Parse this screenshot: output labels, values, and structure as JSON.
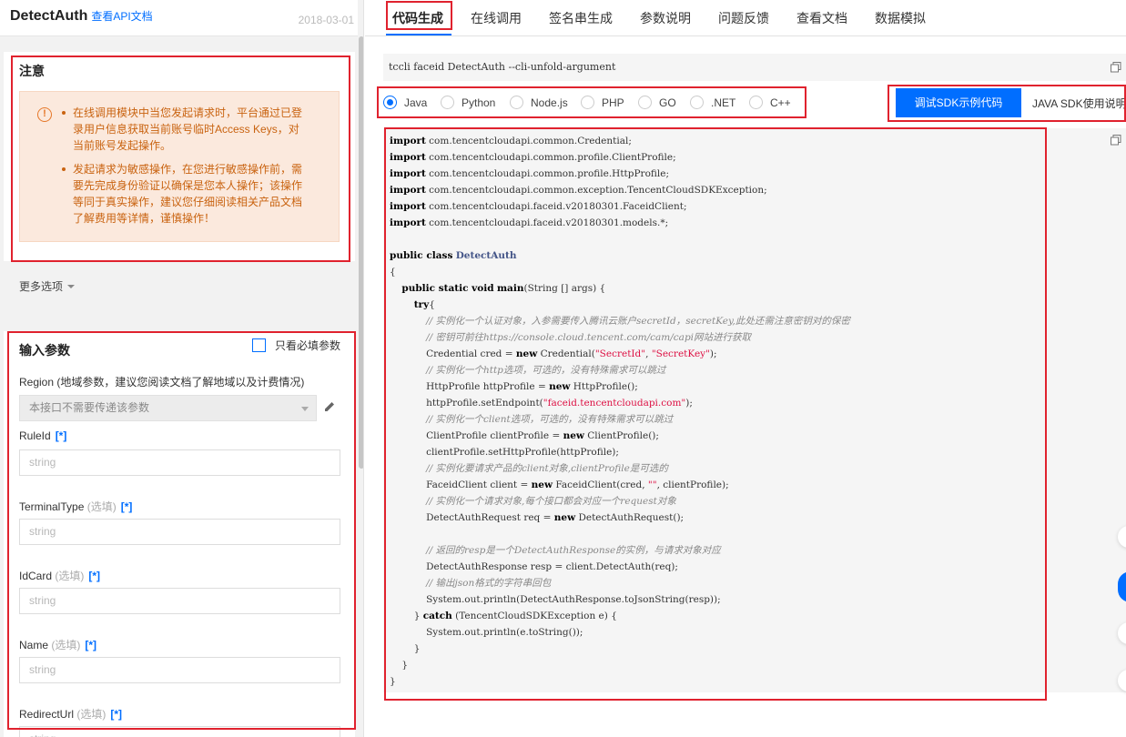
{
  "left": {
    "api_name": "DetectAuth",
    "api_doc_link": "查看API文档",
    "date": "2018-03-01",
    "notice": {
      "title": "注意",
      "items": [
        "在线调用模块中当您发起请求时，平台通过已登录用户信息获取当前账号临时Access Keys，对当前账号发起操作。",
        "发起请求为敏感操作，在您进行敏感操作前，需要先完成身份验证以确保是您本人操作；该操作等同于真实操作，建议您仔细阅读相关产品文档了解费用等详情，谨慎操作！"
      ]
    },
    "more_options": "更多选项",
    "params": {
      "title": "输入参数",
      "required_only_label": "只看必填参数",
      "region_label": "Region",
      "region_hint": "(地域参数，建议您阅读文档了解地域以及计费情况)",
      "region_placeholder": "本接口不需要传递该参数",
      "optional_text": "(选填)",
      "required_mark": "[*]",
      "fields": [
        {
          "name": "RuleId",
          "optional": false,
          "placeholder": "string"
        },
        {
          "name": "TerminalType",
          "optional": true,
          "placeholder": "string"
        },
        {
          "name": "IdCard",
          "optional": true,
          "placeholder": "string"
        },
        {
          "name": "Name",
          "optional": true,
          "placeholder": "string"
        },
        {
          "name": "RedirectUrl",
          "optional": true,
          "placeholder": "string"
        }
      ]
    }
  },
  "tabs": [
    "代码生成",
    "在线调用",
    "签名串生成",
    "参数说明",
    "问题反馈",
    "查看文档",
    "数据模拟"
  ],
  "command": "tccli faceid DetectAuth --cli-unfold-argument",
  "languages": [
    "Java",
    "Python",
    "Node.js",
    "PHP",
    "GO",
    ".NET",
    "C++"
  ],
  "selected_language": "Java",
  "sdk_button": "调试SDK示例代码",
  "sdk_doc": "JAVA SDK使用说明",
  "accent_color": "#006eff",
  "highlight_color": "#e0222e",
  "code": {
    "l1": "com.tencentcloudapi.common.Credential;",
    "l2": "com.tencentcloudapi.common.profile.ClientProfile;",
    "l3": "com.tencentcloudapi.common.profile.HttpProfile;",
    "l4": "com.tencentcloudapi.common.exception.TencentCloudSDKException;",
    "l5": "com.tencentcloudapi.faceid.v20180301.FaceidClient;",
    "l6": "com.tencentcloudapi.faceid.v20180301.models.*;",
    "class_name": "DetectAuth",
    "main_sig": "(String [] args) {",
    "c1": "// 实例化一个认证对象，入参需要传入腾讯云账户secretId，secretKey,此处还需注意密钥对的保密",
    "c2": "// 密钥可前往https://console.cloud.tencent.com/cam/capi网站进行获取",
    "cred_a": "Credential cred = ",
    "cred_b": " Credential(",
    "cred_s1": "\"SecretId\"",
    "cred_s2": "\"SecretKey\"",
    "cred_c": ");",
    "c3": "// 实例化一个http选项，可选的，没有特殊需求可以跳过",
    "hp_a": "HttpProfile httpProfile = ",
    "hp_b": " HttpProfile();",
    "ep_a": "httpProfile.setEndpoint(",
    "ep_s": "\"faceid.tencentcloudapi.com\"",
    "ep_b": ");",
    "c4": "// 实例化一个client选项，可选的，没有特殊需求可以跳过",
    "cp_a": "ClientProfile clientProfile = ",
    "cp_b": " ClientProfile();",
    "shp": "clientProfile.setHttpProfile(httpProfile);",
    "c5": "// 实例化要请求产品的client对象,clientProfile是可选的",
    "fc_a": "FaceidClient client = ",
    "fc_b": " FaceidClient(cred, ",
    "fc_s": "\"\"",
    "fc_c": ", clientProfile);",
    "c6": "// 实例化一个请求对象,每个接口都会对应一个request对象",
    "req_a": "DetectAuthRequest req = ",
    "req_b": " DetectAuthRequest();",
    "c7": "// 返回的resp是一个DetectAuthResponse的实例，与请求对象对应",
    "resp": "DetectAuthResponse resp = client.DetectAuth(req);",
    "c8": "// 输出json格式的字符串回包",
    "print1": "System.out.println(DetectAuthResponse.toJsonString(resp));",
    "catch_b": " (TencentCloudSDKException e) {",
    "print2": "System.out.println(e.toString());"
  }
}
